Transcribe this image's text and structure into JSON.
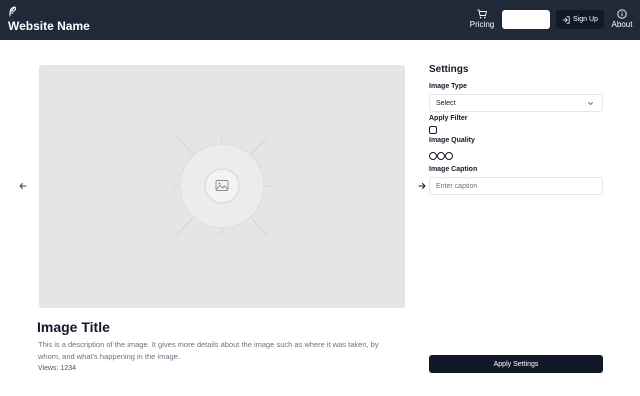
{
  "header": {
    "brand_name": "Website Name",
    "brand_icon": "feather-icon",
    "pricing_label": "Pricing",
    "pricing_icon": "cart-icon",
    "signup_label": "Sign Up",
    "signup_icon": "login-icon",
    "about_label": "About",
    "about_icon": "info-icon"
  },
  "gallery": {
    "prev_icon": "arrow-left-icon",
    "next_icon": "arrow-right-icon",
    "placeholder_icon": "image-icon",
    "title": "Image Title",
    "description": "This is a description of the image. It gives more details about the image such as where it was taken, by whom, and what's happening in the image.",
    "views": "Views: 1234"
  },
  "settings": {
    "title": "Settings",
    "image_type_label": "Image Type",
    "image_type_value": "Select",
    "apply_filter_label": "Apply Filter",
    "image_quality_label": "Image Quality",
    "image_caption_label": "Image Caption",
    "caption_placeholder": "Enter caption",
    "apply_button_label": "Apply Settings"
  },
  "colors": {
    "header_bg": "#1f2937",
    "button_dark": "#111827",
    "image_bg": "#e5e5e5"
  }
}
